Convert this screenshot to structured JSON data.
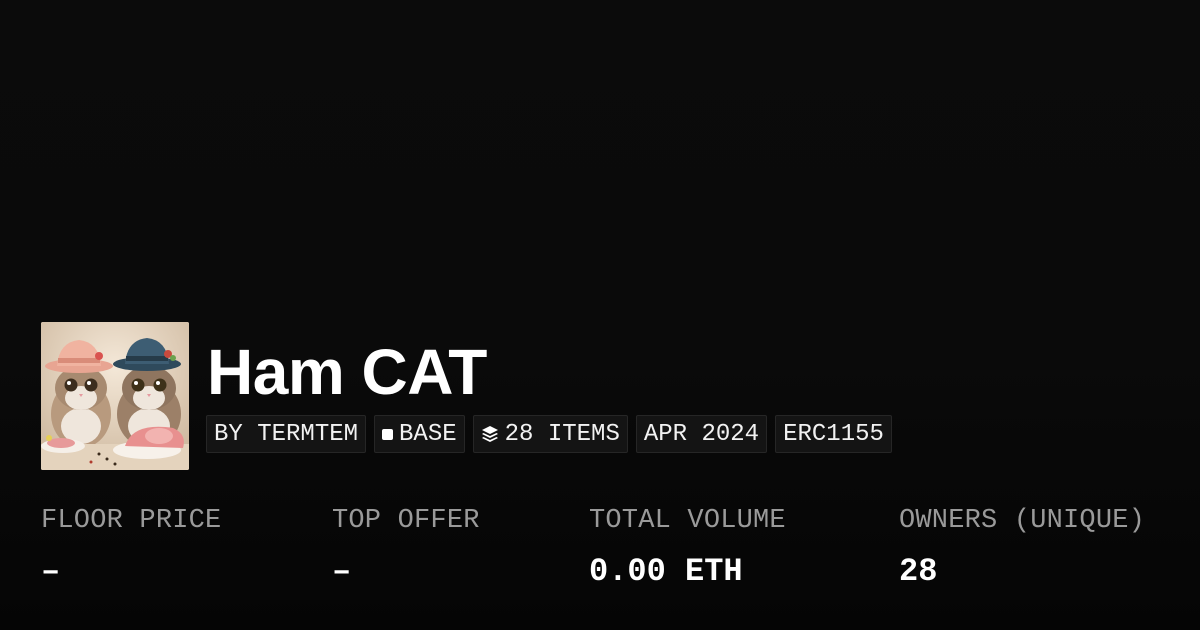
{
  "collection": {
    "name": "Ham CAT",
    "avatar_icon": "cats-with-hats-and-ham-artwork"
  },
  "tags": [
    {
      "label": "BY TERMTEM",
      "icon": ""
    },
    {
      "label": "BASE",
      "icon": "square-icon"
    },
    {
      "label": "28 ITEMS",
      "icon": "layers-icon"
    },
    {
      "label": "APR 2024",
      "icon": ""
    },
    {
      "label": "ERC1155",
      "icon": ""
    }
  ],
  "stats": {
    "floor_price": {
      "label": "FLOOR PRICE",
      "value": "–"
    },
    "top_offer": {
      "label": "TOP OFFER",
      "value": "–"
    },
    "total_volume": {
      "label": "TOTAL VOLUME",
      "value": "0.00 ETH"
    },
    "owners": {
      "label": "OWNERS (UNIQUE)",
      "value": "28"
    }
  },
  "colors": {
    "background": "#0a0a0a",
    "tag_background": "#141414",
    "label_gray": "#9a9a9a",
    "text": "#ffffff"
  }
}
